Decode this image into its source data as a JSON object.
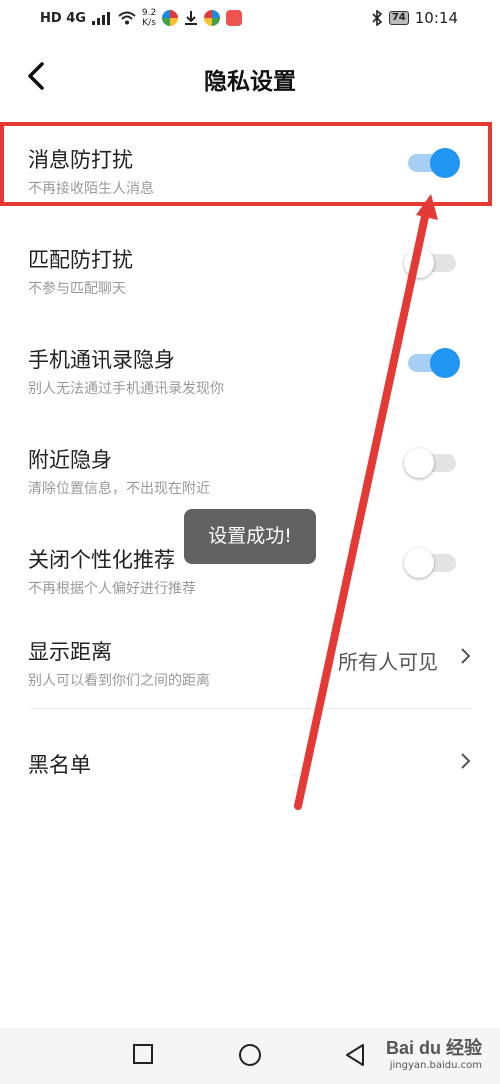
{
  "status_bar": {
    "network": "HD 4G",
    "speed_value": "9.2",
    "speed_unit": "K/s",
    "battery": "74",
    "time": "10:14"
  },
  "header": {
    "title": "隐私设置"
  },
  "settings": [
    {
      "title": "消息防打扰",
      "subtitle": "不再接收陌生人消息",
      "on": true
    },
    {
      "title": "匹配防打扰",
      "subtitle": "不参与匹配聊天",
      "on": false
    },
    {
      "title": "手机通讯录隐身",
      "subtitle": "别人无法通过手机通讯录发现你",
      "on": true
    },
    {
      "title": "附近隐身",
      "subtitle": "清除位置信息，不出现在附近",
      "on": false
    },
    {
      "title": "关闭个性化推荐",
      "subtitle": "不再根据个人偏好进行推荐",
      "on": false
    }
  ],
  "distance": {
    "title": "显示距离",
    "subtitle": "别人可以看到你们之间的距离",
    "value": "所有人可见"
  },
  "blacklist": {
    "title": "黑名单"
  },
  "toast": {
    "text": "设置成功!"
  },
  "watermark": {
    "main": "Bai du 经验",
    "sub": "jingyan.baidu.com"
  },
  "colors": {
    "toggle_on": "#2196f3",
    "highlight": "#e53935"
  }
}
